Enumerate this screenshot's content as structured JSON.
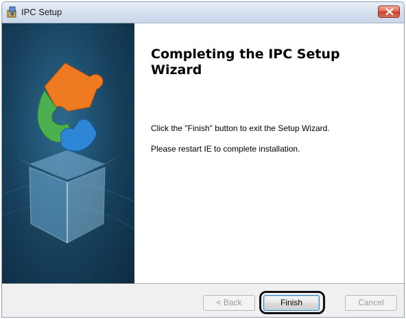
{
  "window": {
    "title": "IPC Setup",
    "title_icon": "installer-icon",
    "close_icon": "close-icon"
  },
  "banner": {
    "image": "puzzle-box-illustration",
    "colors": {
      "orange": "#f07a21",
      "green": "#4caf50",
      "blue": "#2e86d6",
      "background": "#17405c"
    }
  },
  "content": {
    "heading": "Completing the IPC Setup Wizard",
    "line1": "Click the \"Finish\" button to exit the Setup Wizard.",
    "line2": "Please restart IE to complete installation."
  },
  "buttons": {
    "back": "< Back",
    "finish": "Finish",
    "cancel": "Cancel",
    "back_enabled": false,
    "cancel_enabled": false
  }
}
